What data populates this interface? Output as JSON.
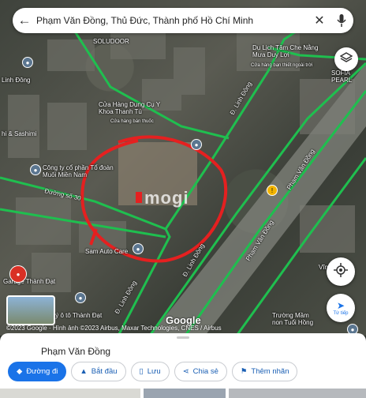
{
  "search": {
    "query": "Phạm Văn Đồng, Thủ Đức, Thành phố Hồ Chí Minh"
  },
  "places": [
    {
      "name": "SOLUDOOR"
    },
    {
      "name": "Dụ Lịch Tâm Che Nằng Mưa Duy Lợi",
      "sub": "Cửa hàng bạn thiết ngoài trời"
    },
    {
      "name": "Linh Đông"
    },
    {
      "name": "SOFIA PEARL"
    },
    {
      "name": "Cửa Hàng Dụng Cụ Y Khoa Thanh Tú",
      "sub": "Cửa hàng bán thuốc"
    },
    {
      "name": "hi & Sashimi"
    },
    {
      "name": "Công ty cổ phần Tổ đoàn Muối Miền Nam"
    },
    {
      "name": "Sam Auto Care"
    },
    {
      "name": "Garage Thành Đạt"
    },
    {
      "name": "ải lý ô tô Thành Đạt"
    },
    {
      "name": "Trường Mầm non Tuổi Hồng"
    },
    {
      "name": "Vĩnh Phúc"
    }
  ],
  "roads": {
    "duong_so_30": "Đường số 30",
    "linh_dong_1": "Đ. Linh Đông",
    "linh_dong_2": "Đ. Linh Đông",
    "linh_dong_3": "Đ. Linh Đông",
    "pham_van_dong_1": "Phạm Văn Đồng",
    "pham_van_dong_2": "Phạm Văn Đồng"
  },
  "map": {
    "watermark": "mogi",
    "attribution": "©2023 Google · Hình ảnh ©2023 Airbus, Maxar Technologies, CNES / Airbus",
    "google": "Google",
    "location_button_label": "Từ tiếp"
  },
  "sheet": {
    "title": "Phạm Văn Đồng",
    "actions": [
      "Đường đi",
      "Bắt đầu",
      "Lưu",
      "Chia sẻ",
      "Thêm nhãn"
    ]
  },
  "colors": {
    "route_green": "#1fbf4f",
    "circle_red": "#e52020",
    "accent_blue": "#1a73e8"
  }
}
